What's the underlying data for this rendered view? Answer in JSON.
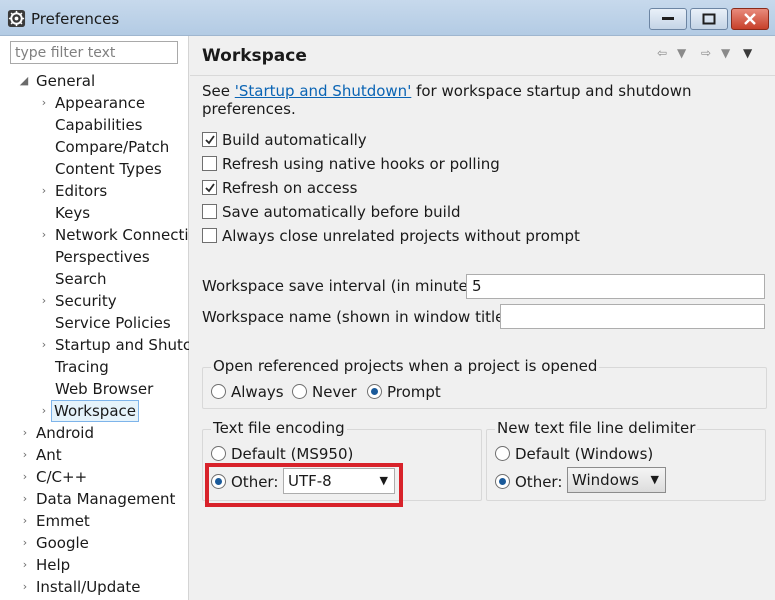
{
  "window": {
    "title": "Preferences"
  },
  "filter": {
    "placeholder": "type filter text"
  },
  "tree": {
    "items": [
      {
        "label": "General",
        "expanded": true
      },
      {
        "label": "Appearance"
      },
      {
        "label": "Capabilities"
      },
      {
        "label": "Compare/Patch"
      },
      {
        "label": "Content Types"
      },
      {
        "label": "Editors"
      },
      {
        "label": "Keys"
      },
      {
        "label": "Network Connecti"
      },
      {
        "label": "Perspectives"
      },
      {
        "label": "Search"
      },
      {
        "label": "Security"
      },
      {
        "label": "Service Policies"
      },
      {
        "label": "Startup and Shutc"
      },
      {
        "label": "Tracing"
      },
      {
        "label": "Web Browser"
      },
      {
        "label": "Workspace",
        "selected": true
      },
      {
        "label": "Android"
      },
      {
        "label": "Ant"
      },
      {
        "label": "C/C++"
      },
      {
        "label": "Data Management"
      },
      {
        "label": "Emmet"
      },
      {
        "label": "Google"
      },
      {
        "label": "Help"
      },
      {
        "label": "Install/Update"
      }
    ]
  },
  "page": {
    "title": "Workspace",
    "desc_prefix": "See ",
    "desc_link": "'Startup and Shutdown'",
    "desc_suffix": " for workspace startup and shutdown preferences."
  },
  "checkboxes": [
    {
      "label": "Build automatically",
      "checked": true
    },
    {
      "label": "Refresh using native hooks or polling",
      "checked": false
    },
    {
      "label": "Refresh on access",
      "checked": true
    },
    {
      "label": "Save automatically before build",
      "checked": false
    },
    {
      "label": "Always close unrelated projects without prompt",
      "checked": false
    }
  ],
  "save_interval": {
    "label": "Workspace save interval (in minutes):",
    "value": "5"
  },
  "workspace_name": {
    "label": "Workspace name (shown in window title):",
    "value": ""
  },
  "open_projects": {
    "title": "Open referenced projects when a project is opened",
    "options": [
      "Always",
      "Never",
      "Prompt"
    ],
    "selected": "Prompt"
  },
  "encoding": {
    "title": "Text file encoding",
    "default_label": "Default (MS950)",
    "other_label": "Other:",
    "other_value": "UTF-8",
    "selected": "other"
  },
  "line_delimiter": {
    "title": "New text file line delimiter",
    "default_label": "Default (Windows)",
    "other_label": "Other:",
    "other_value": "Windows",
    "selected": "other"
  },
  "colors": {
    "highlight": "#d8222a",
    "link": "#0a64b4",
    "selection": "#e5f3fb"
  }
}
